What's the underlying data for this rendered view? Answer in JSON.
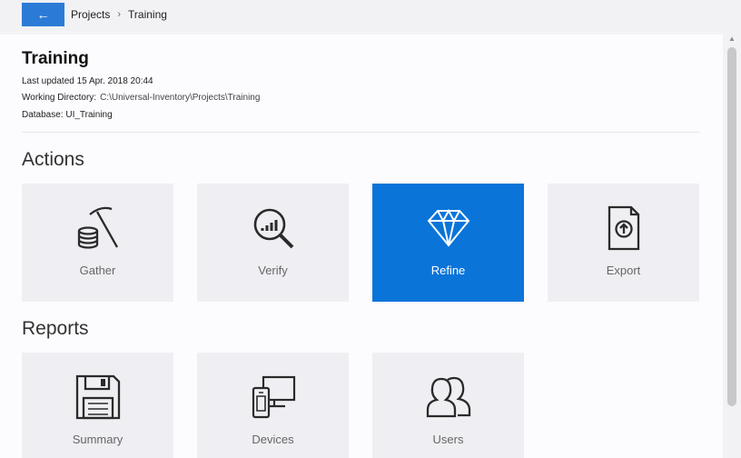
{
  "breadcrumb": {
    "back_icon": "←",
    "parent": "Projects",
    "separator": "›",
    "current": "Training"
  },
  "header": {
    "title": "Training",
    "last_updated": "Last updated 15 Apr. 2018 20:44",
    "working_directory_label": "Working Directory:",
    "working_directory_value": "C:\\Universal-Inventory\\Projects\\Training",
    "database": "Database: UI_Training"
  },
  "actions": {
    "heading": "Actions",
    "tiles": [
      {
        "label": "Gather",
        "icon": "pickaxe-coins-icon"
      },
      {
        "label": "Verify",
        "icon": "magnifier-chart-icon"
      },
      {
        "label": "Refine",
        "icon": "diamond-icon",
        "active": true
      },
      {
        "label": "Export",
        "icon": "document-upload-icon"
      }
    ]
  },
  "reports": {
    "heading": "Reports",
    "tiles": [
      {
        "label": "Summary",
        "icon": "floppy-disk-icon"
      },
      {
        "label": "Devices",
        "icon": "devices-icon"
      },
      {
        "label": "Users",
        "icon": "users-icon"
      }
    ]
  },
  "colors": {
    "accent": "#0a74d9",
    "back_button": "#2b7bd6",
    "tile_bg": "#efeef2"
  }
}
